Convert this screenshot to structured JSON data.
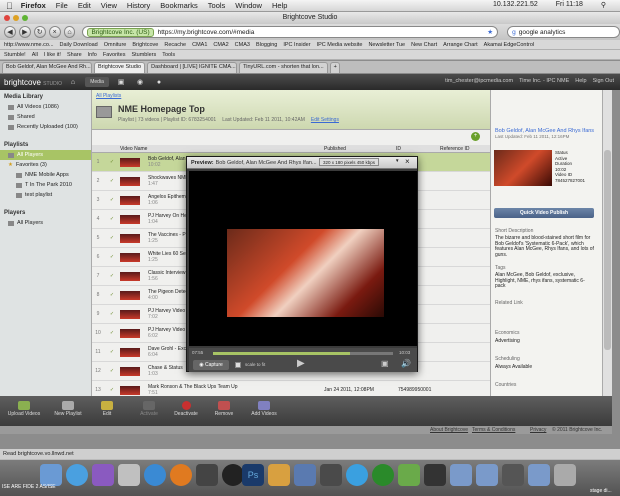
{
  "menubar": {
    "app": "Firefox",
    "items": [
      "File",
      "Edit",
      "View",
      "History",
      "Bookmarks",
      "Tools",
      "Window",
      "Help"
    ],
    "ip": "10.132.221.52",
    "clock": "Fri 11:18"
  },
  "window": {
    "title": "Brightcove Studio"
  },
  "toolbar": {
    "site": "Brightcove Inc. (US)",
    "url": "https://my.brightcove.com/#media",
    "search": "google analytics"
  },
  "bookmarks1": [
    "http://www.nme.co...",
    "Daily Download",
    "Omniture",
    "Brightcove",
    "Recache",
    "CMA1",
    "CMA2",
    "CMA3",
    "Blogging",
    "IPC Insider",
    "IPC Media website",
    "Newsletter Tue",
    "New Chart",
    "Arrange Chart",
    "Akamai EdgeControl"
  ],
  "bookmarks2": [
    "Stumble!",
    "All",
    "I like it!",
    "Share",
    "Info",
    "Favorites",
    "Stumblers",
    "Tools"
  ],
  "tabs": [
    "Bob Geldof, Alan McGee And Rh...",
    "Brightcove Studio",
    "Dashboard | [LIVE] IGNITE CMA...",
    "TinyURL.com - shorten that lon..."
  ],
  "header": {
    "logo_a": "brightcove",
    "logo_b": "STUDIO",
    "media": "Media",
    "user": "tim_chester@ipcmedia.com",
    "org": "Time Inc. - IPC NME",
    "help": "Help",
    "signout": "Sign Out"
  },
  "sidebar": {
    "media_library": "Media Library",
    "library_items": [
      "All Videos (1086)",
      "Shared",
      "Recently Uploaded (100)"
    ],
    "playlists": "Playlists",
    "playlist_items": [
      "All Players",
      "Favorites (3)",
      "NME Mobile Apps",
      "T In The Park 2010",
      "test playlist"
    ],
    "players": "Players",
    "player_items": [
      "All Players"
    ]
  },
  "playlist": {
    "crumb": "All Playlists",
    "title": "NME Homepage Top",
    "meta": "Playlist | 73 videos | Playlist ID: 6783254001",
    "updated": "Last Updated: Feb 11 2011, 10:42AM",
    "edit": "Edit Settings"
  },
  "grid": {
    "headers": [
      "Video Name",
      "Published",
      "ID",
      "Reference ID"
    ]
  },
  "rows": [
    {
      "n": "1",
      "title": "Bob Geldof, Alan McGee And Rhys Ifans",
      "pub": "",
      "id": "7001"
    },
    {
      "n": "2",
      "title": "Shockwaves NME Awards",
      "pub": "",
      "id": "6001"
    },
    {
      "n": "3",
      "title": "Angelos Epithemiou",
      "pub": "",
      "id": "6001"
    },
    {
      "n": "4",
      "title": "PJ Harvey On Her New...",
      "pub": "",
      "id": "6001"
    },
    {
      "n": "5",
      "title": "The Vaccines - Post Break Up Sex",
      "pub": "",
      "id": "6001"
    },
    {
      "n": "6",
      "title": "White Lies 60 Second...",
      "pub": "",
      "id": "6001"
    },
    {
      "n": "7",
      "title": "Classic Interview",
      "pub": "",
      "id": "6001"
    },
    {
      "n": "8",
      "title": "The Pigeon Detectives",
      "pub": "",
      "id": "6001"
    },
    {
      "n": "9",
      "title": "PJ Harvey Video",
      "pub": "",
      "id": "7001"
    },
    {
      "n": "10",
      "title": "PJ Harvey Video",
      "pub": "",
      "id": "6001"
    },
    {
      "n": "11",
      "title": "Dave Grohl - Exclusive",
      "pub": "",
      "id": "6001"
    },
    {
      "n": "12",
      "title": "Chase & Status",
      "pub": "",
      "id": "6001"
    },
    {
      "n": "13",
      "title": "Mark Ronson & The Black Ups Team Up",
      "pub": "Jan 24 2011, 12:08PM",
      "id": "754989950001"
    }
  ],
  "durations": [
    "10:02",
    "1:47",
    "1:06",
    "1:04",
    "1:25",
    "1:25",
    "1:56",
    "4:00",
    "7:02",
    "6:02",
    "6:04",
    "1:03",
    "7:51"
  ],
  "details": {
    "thumb_title": "Bob Geldof, Alan McGee And Rhys Ifans",
    "updated": "Last Updated: Feb 11 2011, 12:16PM",
    "status_label": "Status",
    "status": "Active",
    "duration_label": "Duration",
    "duration": "10:02",
    "videoid_label": "Video ID",
    "videoid": "784527827001",
    "publish": "Quick Video Publish",
    "short_desc_label": "Short Description",
    "short_desc": "The bizarre and blood-stained short film for Bob Geldof's 'Systematic 6-Pack', which features Alan McGee, Rhys Ifans, and lots of guns.",
    "tags_label": "Tags",
    "tags": "Alan McGee, Bob Geldof, exclusive, Highlight, NME, rhys ifans, systematic 6-pack",
    "related_label": "Related Link",
    "economics_label": "Economics",
    "economics": "Advertising",
    "scheduling_label": "Scheduling",
    "scheduling": "Always Available",
    "countries_label": "Countries"
  },
  "bottom": {
    "upload": "Upload Videos",
    "newplaylist": "New Playlist",
    "edit": "Edit",
    "activate": "Activate",
    "deactivate": "Deactivate",
    "remove": "Remove",
    "addvideos": "Add Videos"
  },
  "footer": {
    "links": [
      "About Brightcove",
      "Terms & Conditions",
      "Privacy"
    ],
    "copy": "© 2011 Brightcove Inc."
  },
  "modal": {
    "label": "Preview:",
    "title": "Bob Geldof, Alan McGee And Rhys Ifan...",
    "quality": "320 x 180 pixels 450 kbps",
    "close": "×",
    "time_left": "07:55",
    "time_total": "10:03",
    "capture": "Capture",
    "scale": "scale to fit",
    "progress": 0.76
  },
  "status": {
    "text": "Read brightcove.vo.llnwd.net"
  },
  "dock": {
    "label_left": "ISE ARE FIDE 2 AS/ISE",
    "label_right": "stage di..."
  }
}
